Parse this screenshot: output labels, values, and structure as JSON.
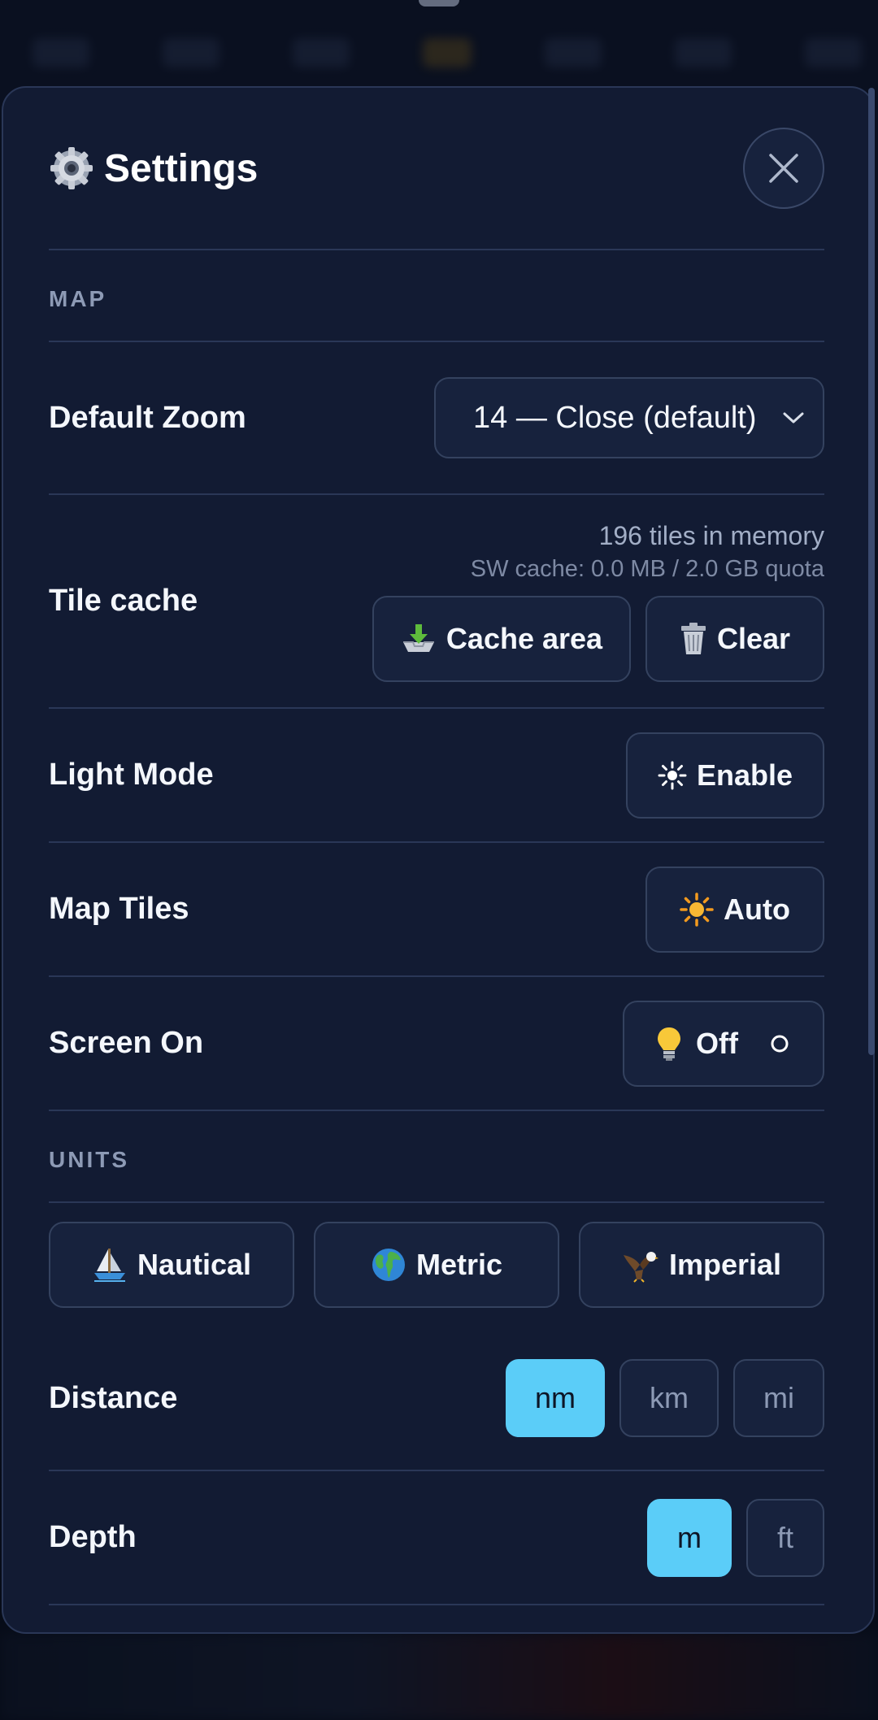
{
  "settings": {
    "title": "Settings",
    "close_icon": "close-icon"
  },
  "map": {
    "section_label": "MAP",
    "default_zoom": {
      "label": "Default Zoom",
      "value": "14 — Close (default)"
    },
    "tile_cache": {
      "label": "Tile cache",
      "tiles_info": "196 tiles in memory",
      "sw_info": "SW cache: 0.0 MB / 2.0 GB quota",
      "cache_area_label": "Cache area",
      "clear_label": "Clear"
    },
    "light_mode": {
      "label": "Light Mode",
      "button_label": "Enable"
    },
    "map_tiles": {
      "label": "Map Tiles",
      "button_label": "Auto"
    },
    "screen_on": {
      "label": "Screen On",
      "button_label": "Off"
    }
  },
  "units": {
    "section_label": "UNITS",
    "presets": [
      {
        "label": "Nautical",
        "icon": "sailboat-icon"
      },
      {
        "label": "Metric",
        "icon": "globe-icon"
      },
      {
        "label": "Imperial",
        "icon": "eagle-icon"
      }
    ],
    "distance": {
      "label": "Distance",
      "options": [
        "nm",
        "km",
        "mi"
      ],
      "selected": "nm"
    },
    "depth": {
      "label": "Depth",
      "options": [
        "m",
        "ft"
      ],
      "selected": "m"
    }
  },
  "colors": {
    "panel_bg": "#121b33",
    "accent": "#5bcdf8",
    "border": "#2a3757"
  }
}
